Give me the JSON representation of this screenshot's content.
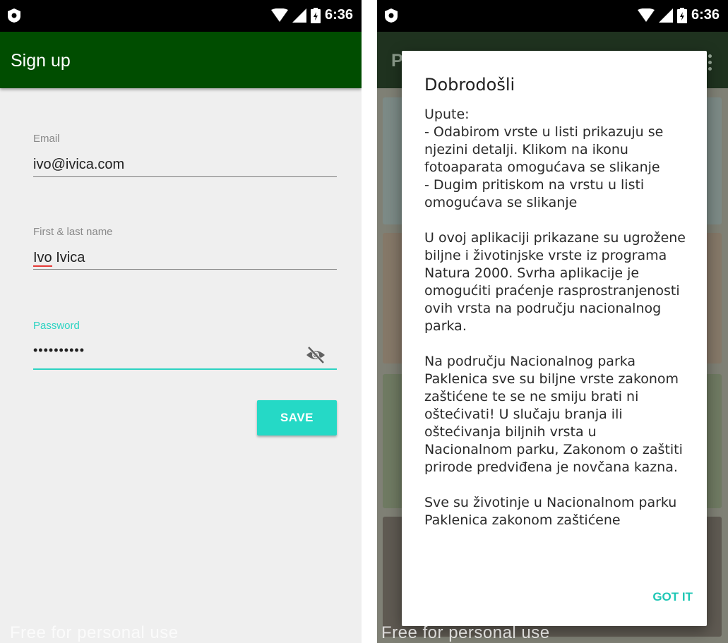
{
  "status": {
    "time": "6:36"
  },
  "signup": {
    "title": "Sign up",
    "email": {
      "label": "Email",
      "value": "ivo@ivica.com"
    },
    "name": {
      "label": "First & last name",
      "value_first": "Ivo",
      "value_rest": " Ivica"
    },
    "password": {
      "label": "Password",
      "value": "••••••••••"
    },
    "save_label": "SAVE"
  },
  "dialog": {
    "title": "Dobrodošli",
    "body": "Upute:\n- Odabirom vrste u listi prikazuju se njezini detalji. Klikom na ikonu fotoaparata omogućava se slikanje\n- Dugim pritiskom na vrstu u listi omogućava se slikanje\n\nU ovoj aplikaciji prikazane su ugrožene biljne i životinjske vrste iz programa Natura 2000. Svrha aplikacije je omogućiti praćenje rasprostranjenosti ovih vrsta na području nacionalnog parka.\n\nNa području Nacionalnog parka Paklenica sve su biljne vrste zakonom zaštićene te se ne smiju brati ni oštećivati! U slučaju branja ili oštećivanja biljnih vrsta u Nacionalnom parku, Zakonom o zaštiti prirode predviđena je novčana kazna.\n\nSve su životinje u Nacionalnom parku Paklenica zakonom zaštićene",
    "button": "GOT IT"
  },
  "appbar_fragment": "P",
  "watermark": "Free for personal use",
  "colors": {
    "appbar": "#004d00",
    "accent": "#25d9c6",
    "background": "#efefef"
  },
  "icons": [
    "shield-icon",
    "wifi-icon",
    "signal-icon",
    "battery-icon",
    "visibility-off-icon",
    "overflow-menu-icon"
  ]
}
